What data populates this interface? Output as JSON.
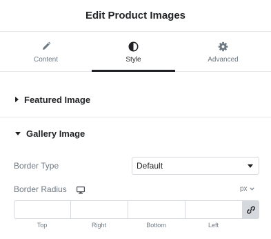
{
  "header": {
    "title": "Edit Product Images"
  },
  "tabs": [
    {
      "label": "Content",
      "icon": "pencil-icon",
      "active": false
    },
    {
      "label": "Style",
      "icon": "contrast-icon",
      "active": true
    },
    {
      "label": "Advanced",
      "icon": "gear-icon",
      "active": false
    }
  ],
  "sections": {
    "featured": {
      "title": "Featured Image",
      "expanded": false
    },
    "gallery": {
      "title": "Gallery Image",
      "expanded": true
    }
  },
  "controls": {
    "border_type": {
      "label": "Border Type",
      "value": "Default"
    },
    "border_radius": {
      "label": "Border Radius",
      "device_icon": "desktop-icon",
      "unit": "px",
      "fields": [
        {
          "label": "Top",
          "value": ""
        },
        {
          "label": "Right",
          "value": ""
        },
        {
          "label": "Bottom",
          "value": ""
        },
        {
          "label": "Left",
          "value": ""
        }
      ],
      "link_icon": "link-icon"
    }
  },
  "colors": {
    "text": "#1f2124",
    "muted": "#6d7882",
    "border": "#d5d8dc",
    "divider": "#e6e8ea"
  }
}
